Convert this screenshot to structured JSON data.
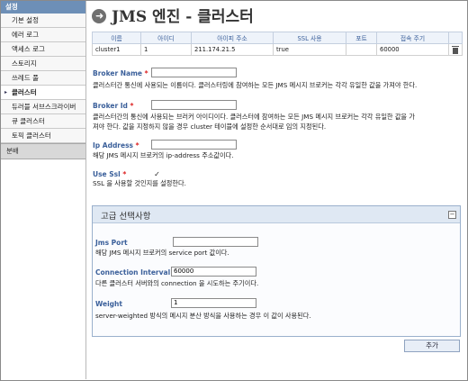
{
  "sidebar": {
    "header": "설정",
    "items": [
      {
        "label": "기본 설정",
        "active": false
      },
      {
        "label": "에러 로그",
        "active": false
      },
      {
        "label": "액세스 로그",
        "active": false
      },
      {
        "label": "스토리지",
        "active": false
      },
      {
        "label": "쓰레드 풀",
        "active": false
      },
      {
        "label": "클러스터",
        "active": true
      },
      {
        "label": "듀러블 서브스크라이버",
        "active": false
      },
      {
        "label": "큐 클러스터",
        "active": false
      },
      {
        "label": "토픽 클러스터",
        "active": false
      }
    ],
    "section": "분배"
  },
  "page": {
    "title": "JMS 엔진 - 클러스터"
  },
  "table": {
    "headers": [
      "이름",
      "아이디",
      "아이피 주소",
      "SSL 사용",
      "포트",
      "접속 주기"
    ],
    "rows": [
      [
        "cluster1",
        "1",
        "211.174.21.5",
        "true",
        "",
        "60000"
      ]
    ]
  },
  "fields": {
    "broker_name": {
      "label": "Broker Name",
      "required": "*",
      "value": "",
      "desc": "클러스터간 통신에 사용되는 이름이다. 클러스터링에 참여하는 모든 JMS 메시지 브로커는 각각 유일한 값을 가져야 한다."
    },
    "broker_id": {
      "label": "Broker Id",
      "required": "*",
      "value": "",
      "desc1": "클러스터간의 통신에 사용되는 브러커 아이디이다. 클러스터에 참여하는 모든 JMS 메시지 브로커는 각각 유일한 값을 가",
      "desc2": "져야 한다. 값을 지정하지 않을 경우 cluster 테이블에 설정한 순서대로 임의 지정된다."
    },
    "ip_address": {
      "label": "Ip Address",
      "required": "*",
      "value": "",
      "desc": "해당 JMS 메시지 브로커의 ip-address 주소값이다."
    },
    "use_ssl": {
      "label": "Use Ssl",
      "required": "*",
      "checked": true,
      "check_glyph": "✓",
      "desc": "SSL 을 사용할 것인지를 설정한다."
    }
  },
  "advanced": {
    "title": "고급 선택사항",
    "collapse_glyph": "−",
    "jms_port": {
      "label": "Jms Port",
      "value": "",
      "desc": "해당 JMS 메시지 브로커의 service port 값이다."
    },
    "connection_interval": {
      "label": "Connection Interval",
      "value": "60000",
      "desc": "다른 클러스터 서버와의 connection 을 시도하는 주기이다."
    },
    "weight": {
      "label": "Weight",
      "value": "1",
      "desc": "server-weighted 방식의 메시지 분산 방식을 사용하는 경우 이 값이 사용된다."
    }
  },
  "buttons": {
    "add": "추가"
  },
  "icons": {
    "title_icon": "arrow-right-circle-icon",
    "title_glyph": "➜",
    "sidebar_active_marker": "▸",
    "delete": "trash-icon"
  },
  "colors": {
    "label_blue": "#3a5f9a",
    "required_red": "#dd2222",
    "sidebar_header": "#6d8fb7"
  }
}
